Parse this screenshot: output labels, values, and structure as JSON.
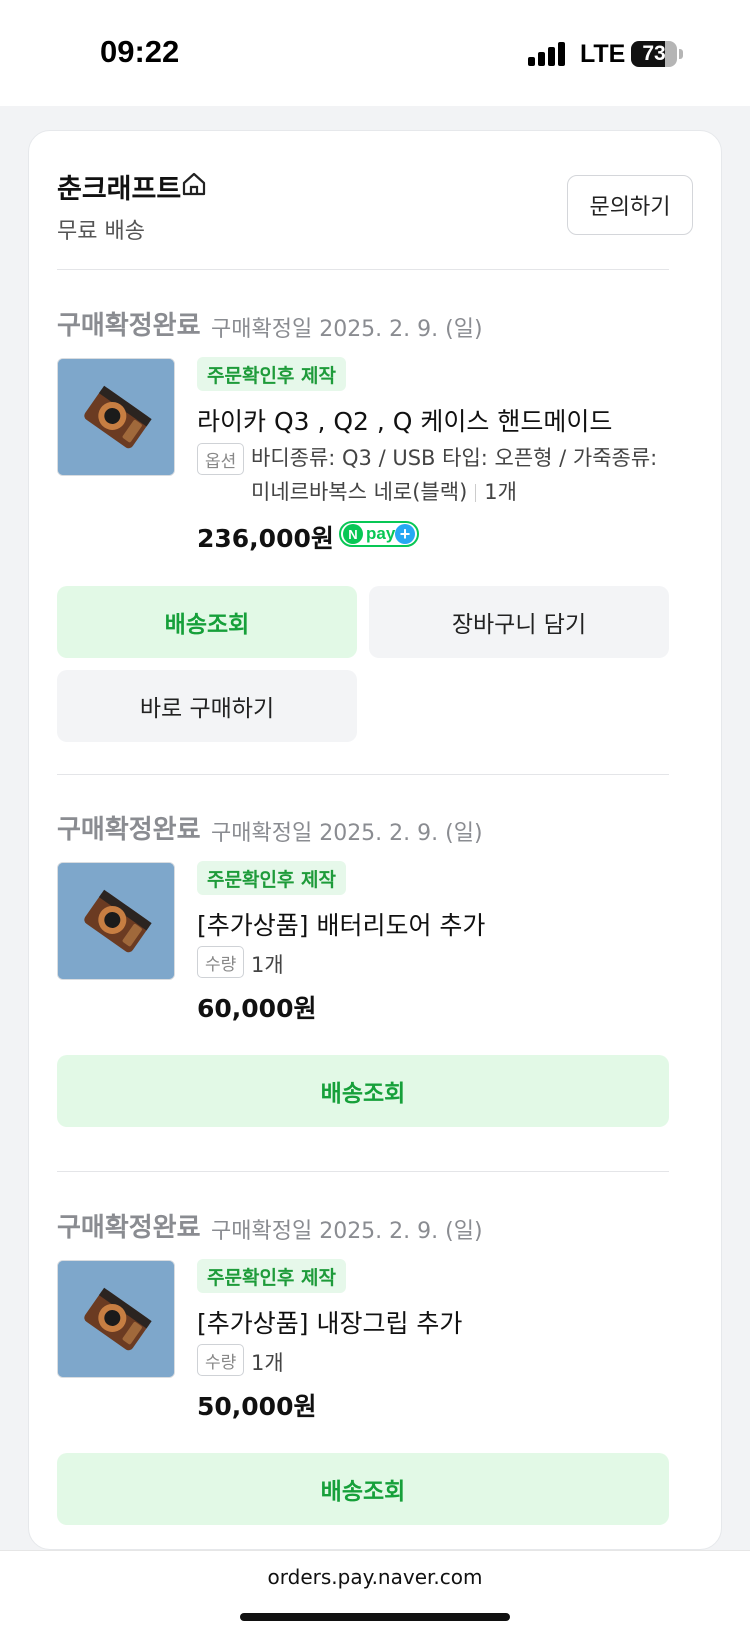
{
  "status_bar": {
    "time": "09:22",
    "network": "LTE",
    "battery": "73",
    "battery_level": 0.73
  },
  "seller": {
    "name": "춘크래프트",
    "shipping": "무료 배송",
    "inquiry_label": "문의하기"
  },
  "orders": [
    {
      "status": "구매확정완료",
      "date": "구매확정일 2025. 2. 9. (일)",
      "badge": "주문확인후 제작",
      "product_name": "라이카 Q3 , Q2 , Q 케이스 핸드메이드",
      "tag": "옵션",
      "option_line1": "바디종류: Q3 / USB 타입: 오픈형 / 가죽종류:",
      "option_line2": "미네르바복스 네로(블랙)",
      "quantity": "1개",
      "price": "236,000원",
      "npay": {
        "n": "N",
        "pay": "pay",
        "plus": "+"
      },
      "buttons": {
        "track": "배송조회",
        "cart": "장바구니 담기",
        "buy_now": "바로 구매하기"
      }
    },
    {
      "status": "구매확정완료",
      "date": "구매확정일 2025. 2. 9. (일)",
      "badge": "주문확인후 제작",
      "product_name": "[추가상품] 배터리도어 추가",
      "tag": "수량",
      "quantity": "1개",
      "price": "60,000원",
      "buttons": {
        "track": "배송조회"
      }
    },
    {
      "status": "구매확정완료",
      "date": "구매확정일 2025. 2. 9. (일)",
      "badge": "주문확인후 제작",
      "product_name": "[추가상품] 내장그립 추가",
      "tag": "수량",
      "quantity": "1개",
      "price": "50,000원",
      "buttons": {
        "track": "배송조회"
      }
    }
  ],
  "browser": {
    "url": "orders.pay.naver.com"
  },
  "colors": {
    "accent_green": "#16a03a",
    "accent_green_bg": "#e2f9e6",
    "npay_green": "#08c755"
  }
}
